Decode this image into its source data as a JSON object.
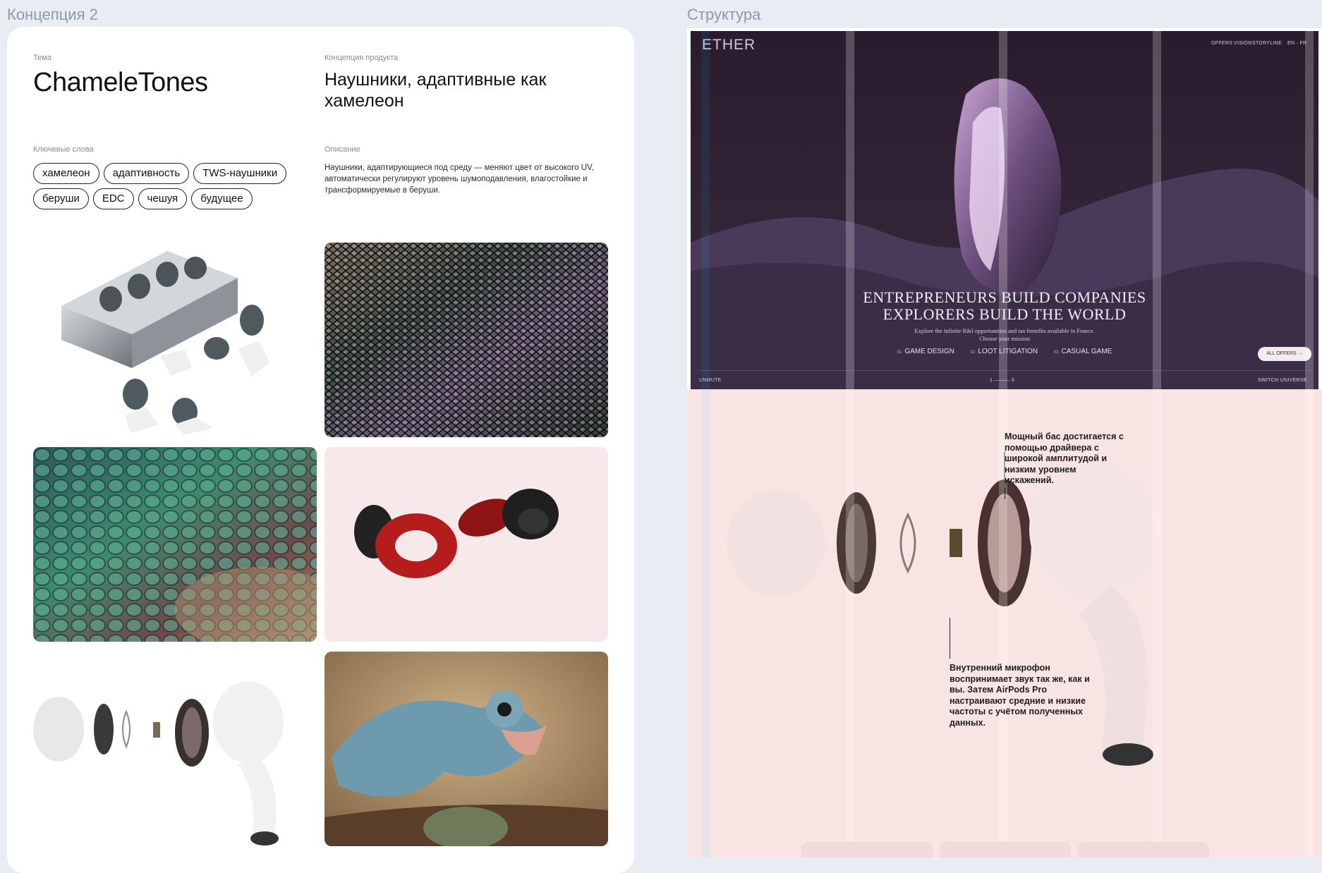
{
  "frames": {
    "left_label": "Концепция 2",
    "right_label": "Структура"
  },
  "concept": {
    "theme_label": "Тема",
    "theme_title": "ChameleTones",
    "product_label": "Концепция продукта",
    "product_title": "Наушники, адаптивные как хамелеон",
    "keywords_label": "Ключевые слова",
    "keywords": [
      "хамелеон",
      "адаптивность",
      "TWS-наушники",
      "беруши",
      "EDC",
      "чешуя",
      "будущее"
    ],
    "description_label": "Описание",
    "description": "Наушники, адаптирующиеся под среду — меняют цвет от высокого UV, автоматически регулируют уровень шумоподавления, влагостойкие и трансформируемые в беруши."
  },
  "moodboard": {
    "images": [
      "earplug-case-photo",
      "snake-scales-photo",
      "chameleon-skin-photo",
      "red-earplugs-photo",
      "airpods-exploded-photo",
      "chameleon-photo"
    ]
  },
  "hero": {
    "logo": "ETHER",
    "nav": [
      "OFFERS",
      "VISION",
      "STORYLINE",
      "EN · FR"
    ],
    "headline_1": "ENTREPRENEURS BUILD COMPANIES",
    "headline_2": "EXPLORERS BUILD THE WORLD",
    "sub_1": "Explore the infinite R&I opportunities and tax benefits available in France.",
    "sub_2": "Choose your mission",
    "crumbs": [
      {
        "num": "01",
        "label": "GAME DESIGN"
      },
      {
        "num": "02",
        "label": "LOOT LITIGATION"
      },
      {
        "num": "03",
        "label": "CASUAL GAME"
      }
    ],
    "cta": "ALL OFFERS →",
    "unmute": "UNMUTE",
    "pager": "1 ——— 3",
    "switch": "SWITCH UNIVERSE"
  },
  "structure": {
    "annotation_bass": "Мощный бас достигается с помощью драйвера с широкой амплитудой и низким уровнем искажений.",
    "annotation_mic": "Внутренний микрофон воспринимает звук так же, как и вы. Затем AirPods Pro настраивают средние и низкие частоты с учётом полученных данных."
  },
  "colors": {
    "page_bg": "#e8edf4",
    "card_bg": "#ffffff",
    "grid_pink": "#f9e4e4",
    "hero_dark": "#2a1c2e"
  }
}
